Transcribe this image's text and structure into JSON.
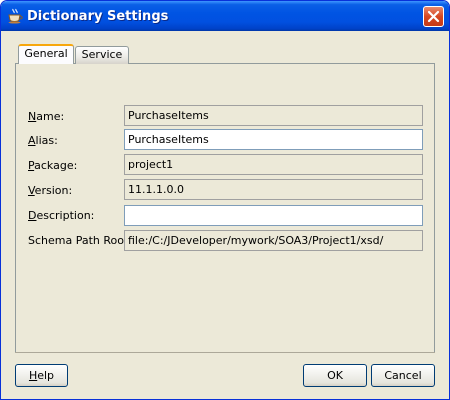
{
  "window": {
    "title": "Dictionary Settings",
    "app_icon": "jdeveloper-cup-icon",
    "close_icon": "close-icon"
  },
  "tabs": [
    {
      "label": "General",
      "selected": true
    },
    {
      "label": "Service",
      "selected": false
    }
  ],
  "form": {
    "name": {
      "label_mnemonic": "N",
      "label_rest": "ame:",
      "value": "PurchaseItems",
      "editable": false
    },
    "alias": {
      "label_mnemonic": "A",
      "label_rest": "lias:",
      "value": "PurchaseItems",
      "editable": true
    },
    "package": {
      "label_mnemonic": "P",
      "label_rest": "ackage:",
      "value": "project1",
      "editable": false
    },
    "version": {
      "label_mnemonic": "V",
      "label_rest": "ersion:",
      "value": "11.1.1.0.0",
      "editable": false
    },
    "description": {
      "label_mnemonic": "D",
      "label_rest": "escription:",
      "value": "",
      "editable": true
    },
    "schema_path_root": {
      "label": "Schema Path Root:",
      "value": "file:/C:/JDeveloper/mywork/SOA3/Project1/xsd/",
      "editable": false
    }
  },
  "buttons": {
    "help_mnemonic": "H",
    "help_rest": "elp",
    "ok": "OK",
    "cancel": "Cancel"
  },
  "colors": {
    "titlebar": "#0054e3",
    "dialog_bg": "#ece9d8",
    "tab_accent": "#f7a70c",
    "close_button": "#d64722"
  }
}
